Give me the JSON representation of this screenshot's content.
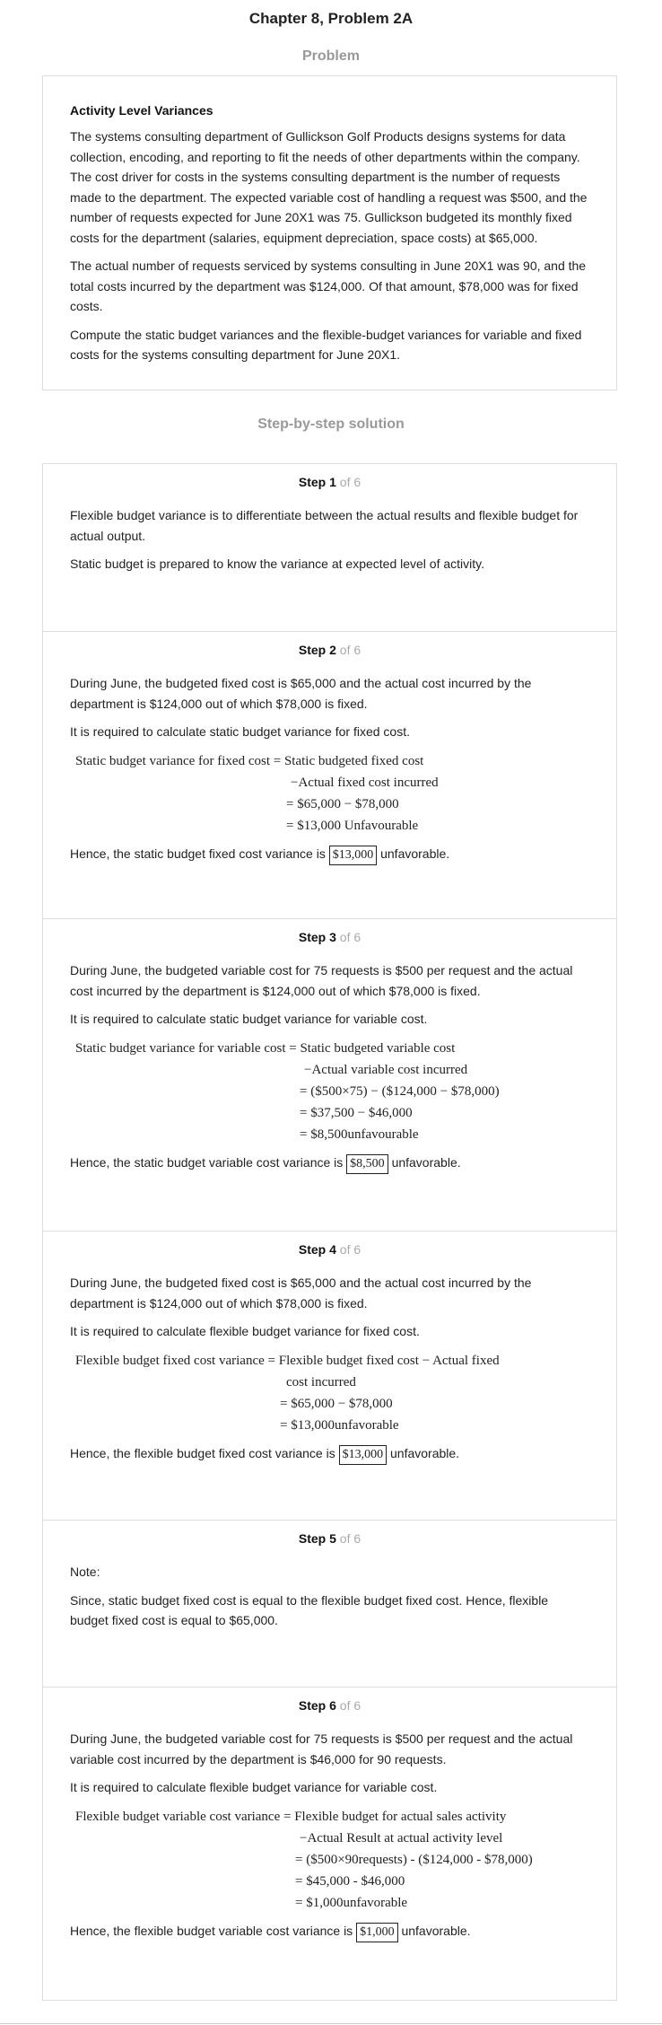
{
  "page_title": "Chapter 8, Problem 2A",
  "problem": {
    "section_label": "Problem",
    "heading": "Activity Level Variances",
    "paragraphs": [
      "The systems consulting department of Gullickson Golf Products designs systems for data collection, encoding, and reporting to fit the needs of other departments within the company. The cost driver for costs in the systems consulting department is the number of requests made to the department. The expected variable cost of handling a request was $500, and the number of requests expected for June 20X1 was 75. Gullickson budgeted its monthly fixed costs for the department (salaries, equipment depreciation, space costs) at $65,000.",
      "The actual number of requests serviced by systems consulting in June 20X1 was 90, and the total costs incurred by the department was $124,000. Of that amount, $78,000 was for fixed costs.",
      "Compute the static budget variances and the flexible-budget variances for variable and fixed costs for the systems consulting department for June 20X1."
    ]
  },
  "solution": {
    "section_label": "Step-by-step solution",
    "step_word": "Step",
    "of_text": "of 6",
    "steps": [
      {
        "number": "1",
        "p1": "Flexible budget variance is to differentiate between the actual results and flexible budget for actual output.",
        "p2": "Static budget is prepared to know the variance at expected level of activity."
      },
      {
        "number": "2",
        "p1": "During June, the budgeted fixed cost is $65,000 and the actual cost incurred by the department is $124,000 out of which $78,000 is fixed.",
        "p2": "It is required to calculate static budget variance for fixed cost.",
        "math": [
          "Static budget variance for fixed cost = Static budgeted fixed cost",
          "−Actual fixed cost incurred",
          "= $65,000 − $78,000",
          "= $13,000 Unfavourable"
        ],
        "conclusion_pre": "Hence, the static budget fixed cost variance is",
        "answer": "$13,000",
        "conclusion_post": "unfavorable."
      },
      {
        "number": "3",
        "p1": "During June, the budgeted variable cost for 75 requests is $500 per request and the actual cost incurred by the department is $124,000 out of which $78,000 is fixed.",
        "p2": "It is required to calculate static budget variance for variable cost.",
        "math": [
          "Static budget variance for variable cost = Static budgeted variable cost",
          "−Actual variable cost incurred",
          "= ($500×75) − ($124,000 − $78,000)",
          "= $37,500 − $46,000",
          "= $8,500unfavourable"
        ],
        "conclusion_pre": "Hence, the static budget variable cost variance is",
        "answer": "$8,500",
        "conclusion_post": "unfavorable."
      },
      {
        "number": "4",
        "p1": "During June, the budgeted fixed cost is $65,000 and the actual cost incurred by the department is $124,000 out of which $78,000 is fixed.",
        "p2": "It is required to calculate flexible budget variance for fixed cost.",
        "math": [
          "Flexible budget fixed cost variance = Flexible budget fixed cost − Actual fixed",
          "cost incurred",
          "= $65,000 − $78,000",
          "= $13,000unfavorable"
        ],
        "conclusion_pre": "Hence, the flexible budget fixed cost variance is",
        "answer": "$13,000",
        "conclusion_post": "unfavorable."
      },
      {
        "number": "5",
        "p1": "Note:",
        "p2": "Since, static budget fixed cost is equal to the flexible budget fixed cost. Hence, flexible budget fixed cost is equal to $65,000."
      },
      {
        "number": "6",
        "p1": "During June, the budgeted variable cost for 75 requests is $500 per request and the actual variable cost incurred by the department is $46,000 for 90 requests.",
        "p2": "It is required to calculate flexible budget variance for variable cost.",
        "math": [
          "Flexible budget variable cost variance = Flexible budget for actual sales activity",
          "−Actual Result at actual activity level",
          "= ($500×90requests) - ($124,000 - $78,000)",
          "= $45,000 - $46,000",
          "= $1,000unfavorable"
        ],
        "conclusion_pre": "Hence, the flexible budget variable cost variance is",
        "answer": "$1,000",
        "conclusion_post": "unfavorable."
      }
    ]
  }
}
